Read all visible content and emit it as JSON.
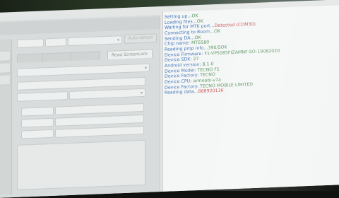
{
  "top_buttons": {
    "right_action": "Auto detect"
  },
  "tabs": [
    {
      "label": ""
    },
    {
      "label": ""
    },
    {
      "label": ""
    },
    {
      "label": "Read ScreenLock"
    }
  ],
  "log": {
    "lines": [
      {
        "label": "Setting up...",
        "value": "OK"
      },
      {
        "label": "Loading files...",
        "value": "OK"
      },
      {
        "label": "Waiting for MTK port...",
        "value": "Detected (COM30)",
        "value_color": "red"
      },
      {
        "label": "Connecting to Boom...",
        "value": "OK"
      },
      {
        "label": "Sending DA...",
        "value": "OK"
      },
      {
        "label": "Chip name: ",
        "value": "MT6580"
      },
      {
        "label": "Reading prop info...",
        "value": "390/SOK"
      },
      {
        "label": "Device Firmware: ",
        "value": "F1-VP5085FIZAMNF-SO-19082020"
      },
      {
        "label": "Device SDK: ",
        "value": "27"
      },
      {
        "label": "Android version: ",
        "value": "8.1.0"
      },
      {
        "label": "Device Model: ",
        "value": "TECNO F1"
      },
      {
        "label": "Device Factory: ",
        "value": "TECNO"
      },
      {
        "label": "Device CPU: ",
        "value": "armeabi-v7a"
      },
      {
        "label": "Device Factory: ",
        "value": "TECNO MOBILE LIMITED"
      },
      {
        "label": "Reading data...",
        "value": "888920136",
        "value_color": "red"
      }
    ]
  },
  "colors": {
    "label": "#3a6fb6",
    "value": "#4f8d55",
    "value_red": "#c24a49"
  }
}
